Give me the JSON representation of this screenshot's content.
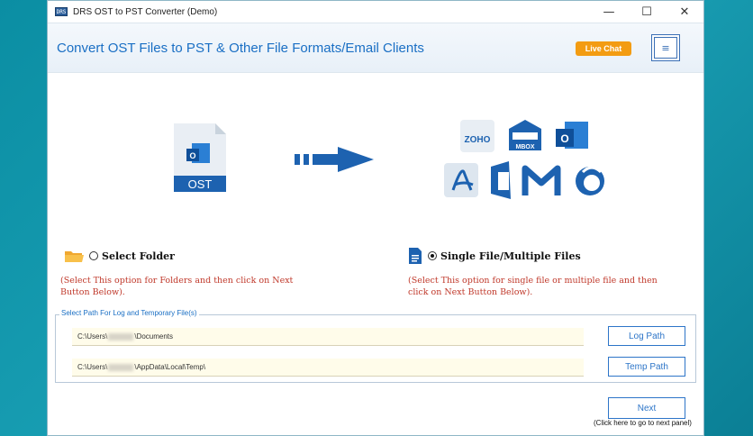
{
  "window": {
    "app_icon_text": "DRS",
    "title": "DRS OST to PST Converter (Demo)",
    "controls": {
      "minimize": "—",
      "maximize": "☐",
      "close": "✕"
    }
  },
  "header": {
    "title": "Convert OST Files to PST & Other File Formats/Email Clients",
    "live_chat_label": "Live Chat",
    "menu_icon": "≡"
  },
  "illustration": {
    "source_file_label": "OST",
    "targets": [
      "ZOHO",
      "MBOX",
      "Outlook",
      "PDF",
      "Office 365",
      "Gmail",
      "Thunderbird"
    ],
    "zoho_text": "ZOHO",
    "mbox_text": "MBOX",
    "outlook_letter": "O",
    "source_letter": "O"
  },
  "options": {
    "folder": {
      "label": "Select Folder",
      "selected": false,
      "description": "(Select This option for Folders and then click on Next Button Below)."
    },
    "file": {
      "label": "Single File/Multiple Files",
      "selected": true,
      "description": "(Select This option for single file or multiple file and then click on Next Button Below)."
    }
  },
  "paths": {
    "legend": "Select Path For Log and Temporary File(s)",
    "log_path_prefix": "C:\\Users\\",
    "log_path_suffix": "\\Documents",
    "temp_path_prefix": "C:\\Users\\",
    "temp_path_suffix": "\\AppData\\Local\\Temp\\",
    "log_button": "Log Path",
    "temp_button": "Temp Path"
  },
  "footer": {
    "next_button": "Next",
    "next_hint": "(Click here to go to next panel)"
  },
  "colors": {
    "accent": "#1a6fc4",
    "live_chat": "#f39c12",
    "description_red": "#c0392b"
  }
}
